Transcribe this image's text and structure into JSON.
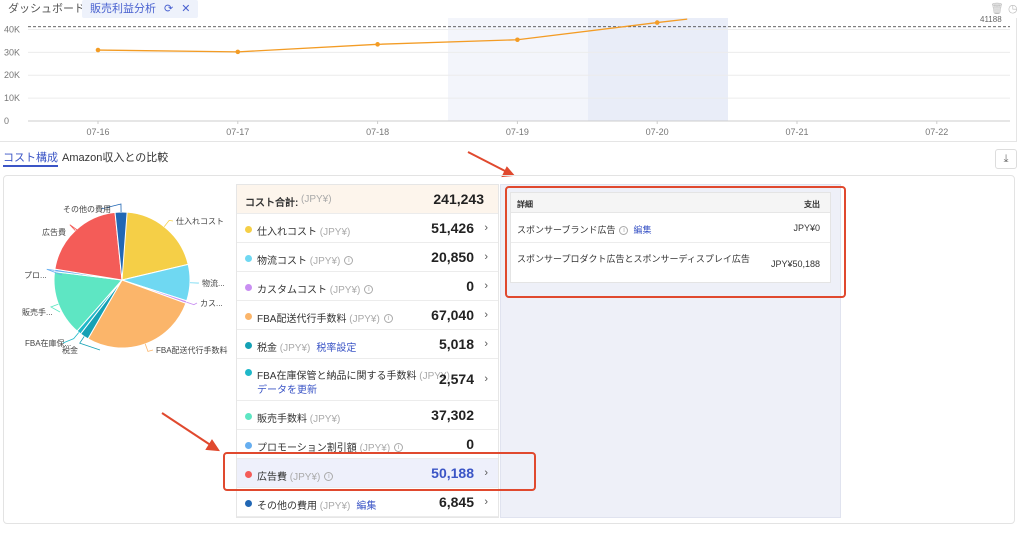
{
  "tabs": {
    "dashboard": "ダッシュボード",
    "analysis": "販売利益分析"
  },
  "top_right_value": "41188",
  "line_chart": {
    "yticks": [
      "40K",
      "30K",
      "20K",
      "10K",
      "0"
    ],
    "xticks": [
      "07-16",
      "07-17",
      "07-18",
      "07-19",
      "07-20",
      "07-21",
      "07-22"
    ]
  },
  "chart_data": {
    "type": "line",
    "x": [
      "07-16",
      "07-17",
      "07-18",
      "07-19",
      "07-20",
      "07-21",
      "07-22"
    ],
    "y": [
      31000,
      30200,
      33500,
      35500,
      43000,
      null,
      null
    ],
    "ylim": [
      0,
      45000
    ],
    "reference_line": 41188,
    "color": "#f39c25"
  },
  "subtabs": {
    "cost": "コスト構成",
    "compare": "Amazon収入との比較"
  },
  "pie": {
    "slices": [
      {
        "label": "仕入れコスト",
        "value": 51426,
        "color": "#f5cf47"
      },
      {
        "label": "物流...",
        "value": 20850,
        "color": "#6fd8f2"
      },
      {
        "label": "カス...",
        "value": 0,
        "color": "#c98ff2"
      },
      {
        "label": "FBA配送代行手数料",
        "value": 67040,
        "color": "#fbb56a"
      },
      {
        "label": "税金",
        "value": 5018,
        "color": "#15a1b5"
      },
      {
        "label": "FBA在庫保...",
        "value": 2574,
        "color": "#1fb8c9"
      },
      {
        "label": "販売手...",
        "value": 37302,
        "color": "#5ee6c3"
      },
      {
        "label": "プロ...",
        "value": 0,
        "color": "#66aef0"
      },
      {
        "label": "広告費",
        "value": 50188,
        "color": "#f45c58"
      },
      {
        "label": "その他の費用",
        "value": 6845,
        "color": "#2167b4"
      }
    ]
  },
  "cost_table": {
    "total_label": "コスト合計:",
    "total_unit": "(JPY¥)",
    "total_value": "241,243",
    "rows": [
      {
        "label": "仕入れコスト",
        "unit": "(JPY¥)",
        "value": "51,426",
        "color": "#f5cf47"
      },
      {
        "label": "物流コスト",
        "unit": "(JPY¥)",
        "value": "20,850",
        "color": "#6fd8f2"
      },
      {
        "label": "カスタムコスト",
        "unit": "(JPY¥)",
        "value": "0",
        "color": "#c98ff2"
      },
      {
        "label": "FBA配送代行手数料",
        "unit": "(JPY¥)",
        "value": "67,040",
        "color": "#fbb56a"
      },
      {
        "label": "税金",
        "unit": "(JPY¥)",
        "link": "税率設定",
        "value": "5,018",
        "color": "#15a1b5"
      },
      {
        "label": "FBA在庫保管と納品に関する手数料",
        "unit": "(JPY¥)",
        "link": "データを更新",
        "value": "2,574",
        "color": "#1fb8c9"
      },
      {
        "label": "販売手数料",
        "unit": "(JPY¥)",
        "value": "37,302",
        "color": "#5ee6c3"
      },
      {
        "label": "プロモーション割引額",
        "unit": "(JPY¥)",
        "value": "0",
        "color": "#66aef0"
      },
      {
        "label": "広告費",
        "unit": "(JPY¥)",
        "value": "50,188",
        "color": "#f45c58"
      },
      {
        "label": "その他の費用",
        "unit": "(JPY¥)",
        "link": "編集",
        "value": "6,845",
        "color": "#2167b4"
      }
    ]
  },
  "detail": {
    "col_detail": "詳細",
    "col_spend": "支出",
    "rows": [
      {
        "name": "スポンサーブランド広告",
        "link": "編集",
        "value": "JPY¥0"
      },
      {
        "name": "スポンサープロダクト広告とスポンサーディスプレイ広告",
        "value": "JPY¥50,188"
      }
    ]
  }
}
